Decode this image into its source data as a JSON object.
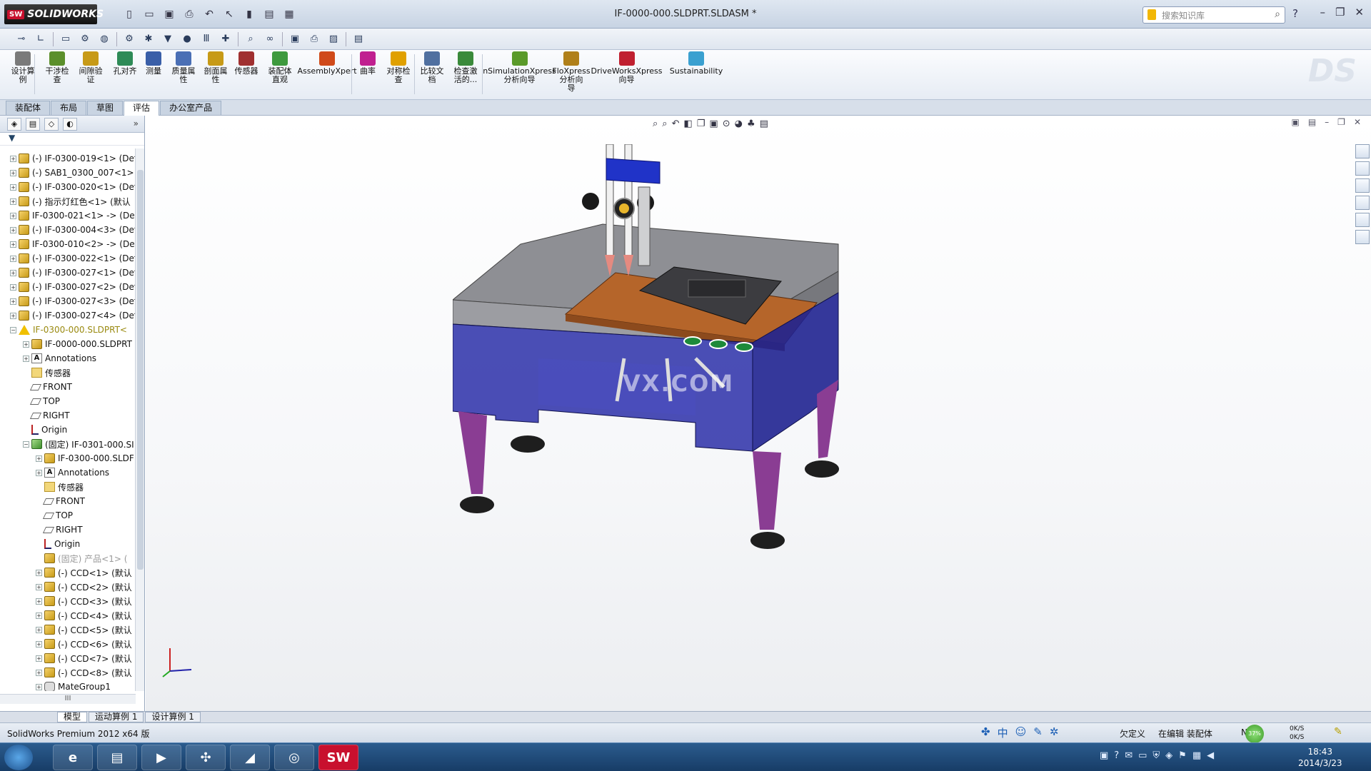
{
  "app": {
    "logo_text": "SOLIDWORKS",
    "logo_badge": "SW",
    "document_title": "IF-0000-000.SLDPRT.SLDASM *",
    "search_placeholder": "搜索知识库",
    "help_label": "?"
  },
  "command_manager": {
    "buttons": [
      {
        "label": "设计算\n例",
        "icon": "design-study-icon",
        "color": "#7a7a7a"
      },
      {
        "label": "干涉检\n查",
        "icon": "interference-check-icon",
        "color": "#5b8f2b"
      },
      {
        "label": "间隙验\n证",
        "icon": "clearance-verification-icon",
        "color": "#c79a17"
      },
      {
        "label": "孔对齐",
        "icon": "hole-alignment-icon",
        "color": "#2e8b57"
      },
      {
        "label": "测量",
        "icon": "measure-icon",
        "color": "#3a5fa8"
      },
      {
        "label": "质量属\n性",
        "icon": "mass-properties-icon",
        "color": "#4a6fb5"
      },
      {
        "label": "剖面属\n性",
        "icon": "section-properties-icon",
        "color": "#c79a17"
      },
      {
        "label": "传感器",
        "icon": "sensor-icon",
        "color": "#a03030"
      },
      {
        "label": "装配体\n直观",
        "icon": "assembly-visualization-icon",
        "color": "#3e9a3e"
      },
      {
        "label": "AssemblyXpert",
        "icon": "assemblyxpert-icon",
        "color": "#d04a1a"
      },
      {
        "label": "曲率",
        "icon": "curvature-icon",
        "color": "#c02090"
      },
      {
        "label": "对称检\n查",
        "icon": "symmetry-check-icon",
        "color": "#e0a000"
      },
      {
        "label": "比较文\n档",
        "icon": "compare-documents-icon",
        "color": "#5070a0"
      },
      {
        "label": "检查激\n活的...",
        "icon": "check-active-icon",
        "color": "#3a8a3a"
      },
      {
        "label": "nSimulationXpress\n分析向导",
        "icon": "simulationxpress-icon",
        "color": "#5a9a2a"
      },
      {
        "label": "FloXpress\n分析向\n导",
        "icon": "floxpress-icon",
        "color": "#b0801a"
      },
      {
        "label": "DriveWorksXpress\n向导",
        "icon": "driveworksxpress-icon",
        "color": "#c02030"
      },
      {
        "label": "Sustainability",
        "icon": "sustainability-icon",
        "color": "#3aa0d0"
      }
    ],
    "tabs": [
      "装配体",
      "布局",
      "草图",
      "评估",
      "办公室产品"
    ],
    "active_tab": "评估"
  },
  "feature_tree": {
    "items": [
      {
        "label": "(-) IF-0300-019<1> (Def",
        "icon": "part",
        "indent": 0,
        "exp": "+"
      },
      {
        "label": "(-) SAB1_0300_007<1> (",
        "icon": "part",
        "indent": 0,
        "exp": "+"
      },
      {
        "label": "(-) IF-0300-020<1> (Def",
        "icon": "part",
        "indent": 0,
        "exp": "+"
      },
      {
        "label": "(-) 指示灯红色<1> (默认",
        "icon": "part",
        "indent": 0,
        "exp": "+"
      },
      {
        "label": "IF-0300-021<1> -> (De",
        "icon": "part",
        "indent": 0,
        "exp": "+"
      },
      {
        "label": "(-) IF-0300-004<3> (Def",
        "icon": "part",
        "indent": 0,
        "exp": "+"
      },
      {
        "label": "IF-0300-010<2> -> (De",
        "icon": "part",
        "indent": 0,
        "exp": "+"
      },
      {
        "label": "(-) IF-0300-022<1> (Def",
        "icon": "part",
        "indent": 0,
        "exp": "+"
      },
      {
        "label": "(-) IF-0300-027<1> (Def",
        "icon": "part",
        "indent": 0,
        "exp": "+"
      },
      {
        "label": "(-) IF-0300-027<2> (Def",
        "icon": "part",
        "indent": 0,
        "exp": "+"
      },
      {
        "label": "(-) IF-0300-027<3> (Def",
        "icon": "part",
        "indent": 0,
        "exp": "+"
      },
      {
        "label": "(-) IF-0300-027<4> (Def",
        "icon": "part",
        "indent": 0,
        "exp": "+"
      },
      {
        "label": "IF-0300-000.SLDPRT<",
        "icon": "warn",
        "indent": 0,
        "exp": "-",
        "style": "warn"
      },
      {
        "label": "IF-0000-000.SLDPRT",
        "icon": "part",
        "indent": 1,
        "exp": "+"
      },
      {
        "label": "Annotations",
        "icon": "annot",
        "indent": 1,
        "exp": "+"
      },
      {
        "label": "传感器",
        "icon": "folder",
        "indent": 1,
        "exp": ""
      },
      {
        "label": "FRONT",
        "icon": "plane",
        "indent": 1,
        "exp": ""
      },
      {
        "label": "TOP",
        "icon": "plane",
        "indent": 1,
        "exp": ""
      },
      {
        "label": "RIGHT",
        "icon": "plane",
        "indent": 1,
        "exp": ""
      },
      {
        "label": "Origin",
        "icon": "origin",
        "indent": 1,
        "exp": ""
      },
      {
        "label": "(固定) IF-0301-000.SI",
        "icon": "asm",
        "indent": 1,
        "exp": "-"
      },
      {
        "label": "IF-0300-000.SLDF",
        "icon": "part",
        "indent": 2,
        "exp": "+"
      },
      {
        "label": "Annotations",
        "icon": "annot",
        "indent": 2,
        "exp": "+"
      },
      {
        "label": "传感器",
        "icon": "folder",
        "indent": 2,
        "exp": ""
      },
      {
        "label": "FRONT",
        "icon": "plane",
        "indent": 2,
        "exp": ""
      },
      {
        "label": "TOP",
        "icon": "plane",
        "indent": 2,
        "exp": ""
      },
      {
        "label": "RIGHT",
        "icon": "plane",
        "indent": 2,
        "exp": ""
      },
      {
        "label": "Origin",
        "icon": "origin",
        "indent": 2,
        "exp": ""
      },
      {
        "label": "(固定) 产品<1> (",
        "icon": "part",
        "indent": 2,
        "exp": "",
        "style": "dim"
      },
      {
        "label": "(-) CCD<1> (默认",
        "icon": "part",
        "indent": 2,
        "exp": "+"
      },
      {
        "label": "(-) CCD<2> (默认",
        "icon": "part",
        "indent": 2,
        "exp": "+"
      },
      {
        "label": "(-) CCD<3> (默认",
        "icon": "part",
        "indent": 2,
        "exp": "+"
      },
      {
        "label": "(-) CCD<4> (默认",
        "icon": "part",
        "indent": 2,
        "exp": "+"
      },
      {
        "label": "(-) CCD<5> (默认",
        "icon": "part",
        "indent": 2,
        "exp": "+"
      },
      {
        "label": "(-) CCD<6> (默认",
        "icon": "part",
        "indent": 2,
        "exp": "+"
      },
      {
        "label": "(-) CCD<7> (默认",
        "icon": "part",
        "indent": 2,
        "exp": "+"
      },
      {
        "label": "(-) CCD<8> (默认",
        "icon": "part",
        "indent": 2,
        "exp": "+"
      },
      {
        "label": "MateGroup1",
        "icon": "mate",
        "indent": 2,
        "exp": "+"
      }
    ],
    "scroll_label": "III"
  },
  "bottom_tabs": [
    "模型",
    "运动算例 1",
    "设计算例 1"
  ],
  "bottom_active": "模型",
  "status": {
    "text": "SolidWorks Premium 2012 x64 版",
    "undefined": "欠定义",
    "editing": "在编辑 装配体",
    "help": "N",
    "net_percent": "37%",
    "upload": "0K/S",
    "download": "0K/S"
  },
  "viewport": {
    "watermark": "VX.COM"
  },
  "taskbar": {
    "time": "18:43",
    "date": "2014/3/23",
    "sw_label": "SW"
  }
}
